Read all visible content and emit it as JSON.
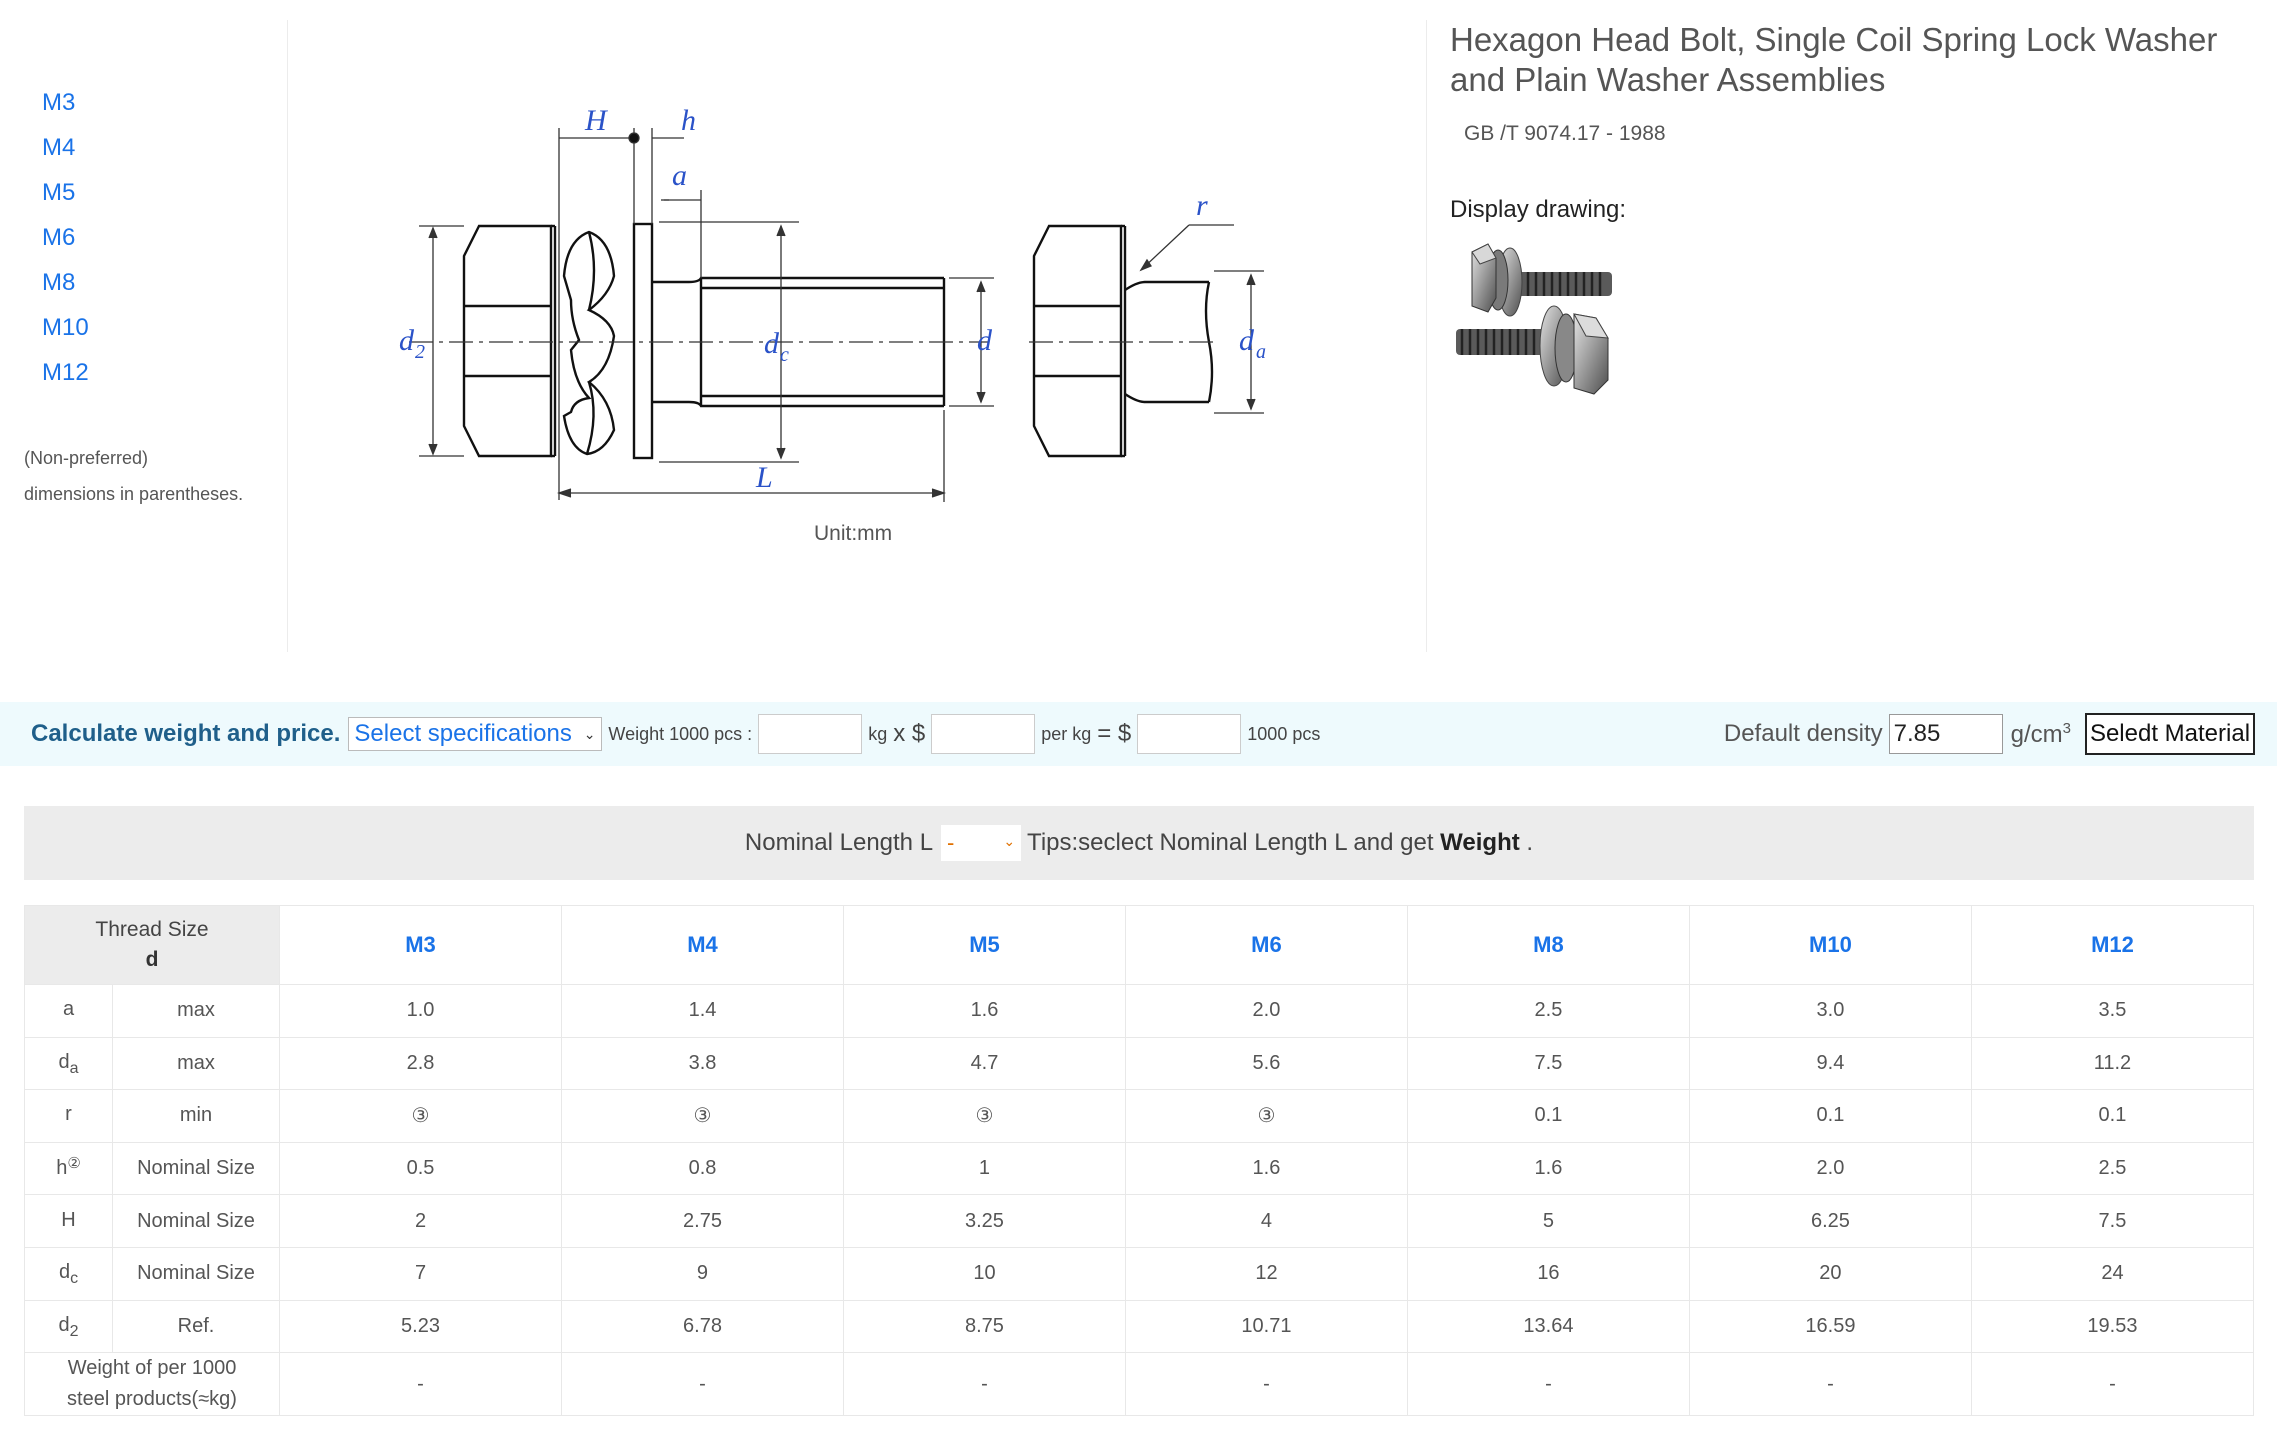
{
  "sidebar": {
    "sizes": [
      "M3",
      "M4",
      "M5",
      "M6",
      "M8",
      "M10",
      "M12"
    ],
    "note_line1": "(Non-preferred)",
    "note_line2": "dimensions in parentheses."
  },
  "drawing": {
    "labels": {
      "H": "H",
      "h": "h",
      "a": "a",
      "r": "r",
      "d2": "d",
      "d2_sub": "2",
      "dc": "d",
      "dc_sub": "c",
      "d": "d",
      "da": "d",
      "da_sub": "a",
      "L": "L"
    },
    "unit": "Unit:mm"
  },
  "header": {
    "title": "Hexagon Head Bolt, Single Coil Spring Lock Washer and Plain Washer Assemblies",
    "standard": "GB /T 9074.17 - 1988",
    "display_label": "Display drawing:"
  },
  "calculator": {
    "title": "Calculate weight and price.",
    "select_label": "Select specifications",
    "weight_label": "Weight 1000 pcs :",
    "kg_label": "kg",
    "times": "x $",
    "per_kg": "per kg",
    "equals": "= $",
    "pcs_label": "1000 pcs",
    "density_label": "Default density",
    "density_value": "7.85",
    "density_unit": "g/cm",
    "density_exp": "3",
    "material_button": "Seledt Material"
  },
  "nominal": {
    "label": "Nominal Length L",
    "selected": "-",
    "tips_prefix": "Tips:seclect Nominal Length L and get ",
    "tips_bold": "Weight",
    "tips_suffix": " ."
  },
  "table": {
    "header_line1": "Thread Size",
    "header_line2": "d",
    "sizes": [
      "M3",
      "M4",
      "M5",
      "M6",
      "M8",
      "M10",
      "M12"
    ],
    "rows": [
      {
        "sym": "a",
        "sub": "",
        "mark": "",
        "qual": "max",
        "values": [
          "1.0",
          "1.4",
          "1.6",
          "2.0",
          "2.5",
          "3.0",
          "3.5"
        ]
      },
      {
        "sym": "d",
        "sub": "a",
        "mark": "",
        "qual": "max",
        "values": [
          "2.8",
          "3.8",
          "4.7",
          "5.6",
          "7.5",
          "9.4",
          "11.2"
        ]
      },
      {
        "sym": "r",
        "sub": "",
        "mark": "",
        "qual": "min",
        "values": [
          "③",
          "③",
          "③",
          "③",
          "0.1",
          "0.1",
          "0.1"
        ]
      },
      {
        "sym": "h",
        "sub": "",
        "mark": "②",
        "qual": "Nominal Size",
        "values": [
          "0.5",
          "0.8",
          "1",
          "1.6",
          "1.6",
          "2.0",
          "2.5"
        ]
      },
      {
        "sym": "H",
        "sub": "",
        "mark": "",
        "qual": "Nominal Size",
        "values": [
          "2",
          "2.75",
          "3.25",
          "4",
          "5",
          "6.25",
          "7.5"
        ]
      },
      {
        "sym": "d",
        "sub": "c",
        "mark": "",
        "qual": "Nominal Size",
        "values": [
          "7",
          "9",
          "10",
          "12",
          "16",
          "20",
          "24"
        ]
      },
      {
        "sym": "d",
        "sub": "2",
        "mark": "",
        "qual": "Ref.",
        "values": [
          "5.23",
          "6.78",
          "8.75",
          "10.71",
          "13.64",
          "16.59",
          "19.53"
        ]
      }
    ],
    "weight_label_line1": "Weight of per 1000",
    "weight_label_line2": "steel products(≈kg)",
    "weights": [
      "-",
      "-",
      "-",
      "-",
      "-",
      "-",
      "-"
    ]
  }
}
